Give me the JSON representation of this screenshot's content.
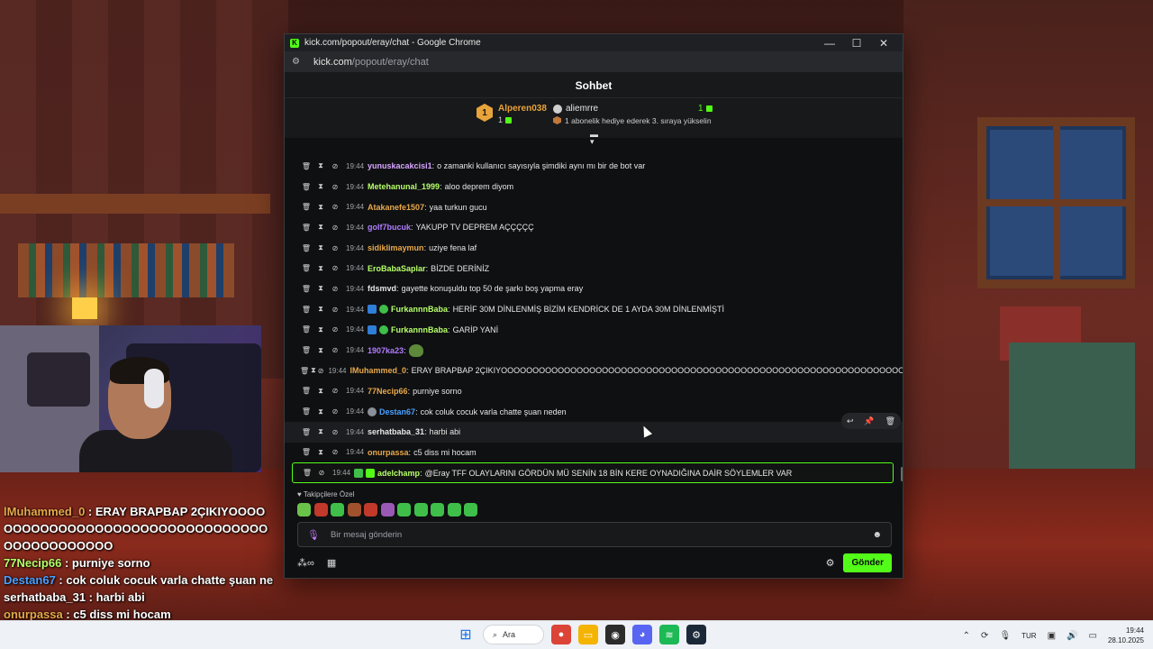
{
  "window": {
    "title": "kick.com/popout/eray/chat - Google Chrome",
    "url_host": "kick.com",
    "url_path": "/popout/eray/chat",
    "controls": {
      "minimize": "—",
      "maximize": "☐",
      "close": "✕"
    }
  },
  "chat": {
    "header": "Sohbet",
    "top_gifter": {
      "rank": "1",
      "name": "Alperen038",
      "count": "1"
    },
    "second_gifter": {
      "name": "aliemrre",
      "count": "1"
    },
    "gift_hint": "1 abonelik hediye ederek 3. sıraya yükselin",
    "messages": [
      {
        "time": "19:44",
        "user": "yunuskacakcisi1",
        "color": "#d7a6ff",
        "text": "o zamanki kullanıcı sayısıyla şimdiki aynı mı bir de bot var"
      },
      {
        "time": "19:44",
        "user": "Metehanunal_1999",
        "color": "#b6ff6a",
        "text": "aloo deprem diyom"
      },
      {
        "time": "19:44",
        "user": "Atakanefe1507",
        "color": "#e8a94a",
        "text": "yaa turkun gucu"
      },
      {
        "time": "19:44",
        "user": "golf7bucuk",
        "color": "#b07cff",
        "text": "YAKUPP TV DEPREM AÇÇÇÇÇ"
      },
      {
        "time": "19:44",
        "user": "sidiklimaymun",
        "color": "#e8a94a",
        "text": "uziye fena laf"
      },
      {
        "time": "19:44",
        "user": "EroBabaSaplar",
        "color": "#b6ff6a",
        "text": "BİZDE DERİNİZ"
      },
      {
        "time": "19:44",
        "user": "fdsmvd",
        "color": "#e6e6e6",
        "text": "gayette konuşuldu top 50 de şarkı boş yapma eray"
      },
      {
        "time": "19:44",
        "user": "FurkannnBaba",
        "color": "#b6ff6a",
        "text": "HERİF 30M DİNLENMİŞ BİZİM KENDRİCK DE 1 AYDA 30M DİNLENMİŞTİ"
      },
      {
        "time": "19:44",
        "user": "FurkannnBaba",
        "color": "#b6ff6a",
        "text": "GARİP YANİ"
      },
      {
        "time": "19:44",
        "user": "1907ka23",
        "color": "#b07cff",
        "text": ""
      },
      {
        "time": "19:44",
        "user": "lMuhammed_0",
        "color": "#e8a94a",
        "text": "ERAY BRAPBAP 2ÇIKIYOOOOOOOOOOOOOOOOOOOOOOOOOOOOOOOOOOOOOOOOOOOOOOOOOOOOOOOOOOOOOOOOOOOO"
      },
      {
        "time": "19:44",
        "user": "77Necip66",
        "color": "#e8a94a",
        "text": "purniye sorno"
      },
      {
        "time": "19:44",
        "user": "Destan67",
        "color": "#4aa0ff",
        "text": "cok coluk cocuk varla chatte şuan neden"
      },
      {
        "time": "19:44",
        "user": "serhatbaba_31",
        "color": "#e6e6e6",
        "text": "harbi abi"
      },
      {
        "time": "19:44",
        "user": "onurpassa",
        "color": "#e8a94a",
        "text": "c5 diss mi hocam"
      },
      {
        "time": "19:44",
        "user": "adelchamp",
        "color": "#b6ff6a",
        "text": "@Eray TFF OLAYLARINI GÖRDÜN MÜ SENİN 18 BİN KERE OYNADIĞINA DAİR SÖYLEMLER VAR"
      }
    ],
    "followers_label": "Takipçilere Özel",
    "input_placeholder": "Bir mesaj gönderin",
    "send_label": "Gönder"
  },
  "overlay": {
    "lines": [
      {
        "user": "lMuhammed_0",
        "text": " : ERAY BRAPBAP 2ÇIKIYOOOOOOOOOOOOOOOOOOOOOOOOOOOOOOOOOOOOOOOOOOOOO"
      },
      {
        "user": "77Necip66",
        "text": " : purniye sorno"
      },
      {
        "user": "Destan67",
        "text": " : cok coluk cocuk varla chatte şuan ne"
      },
      {
        "user": "serhatbaba_31",
        "text": " : harbi abi"
      },
      {
        "user": "onurpassa",
        "text": " : c5 diss mi hocam"
      }
    ]
  },
  "taskbar": {
    "search": "Ara",
    "lang": "TUR",
    "time": "19:44",
    "date": "28.10.2025"
  },
  "colors": {
    "kick_green": "#53fc18",
    "accent_orange": "#e8a33a"
  }
}
